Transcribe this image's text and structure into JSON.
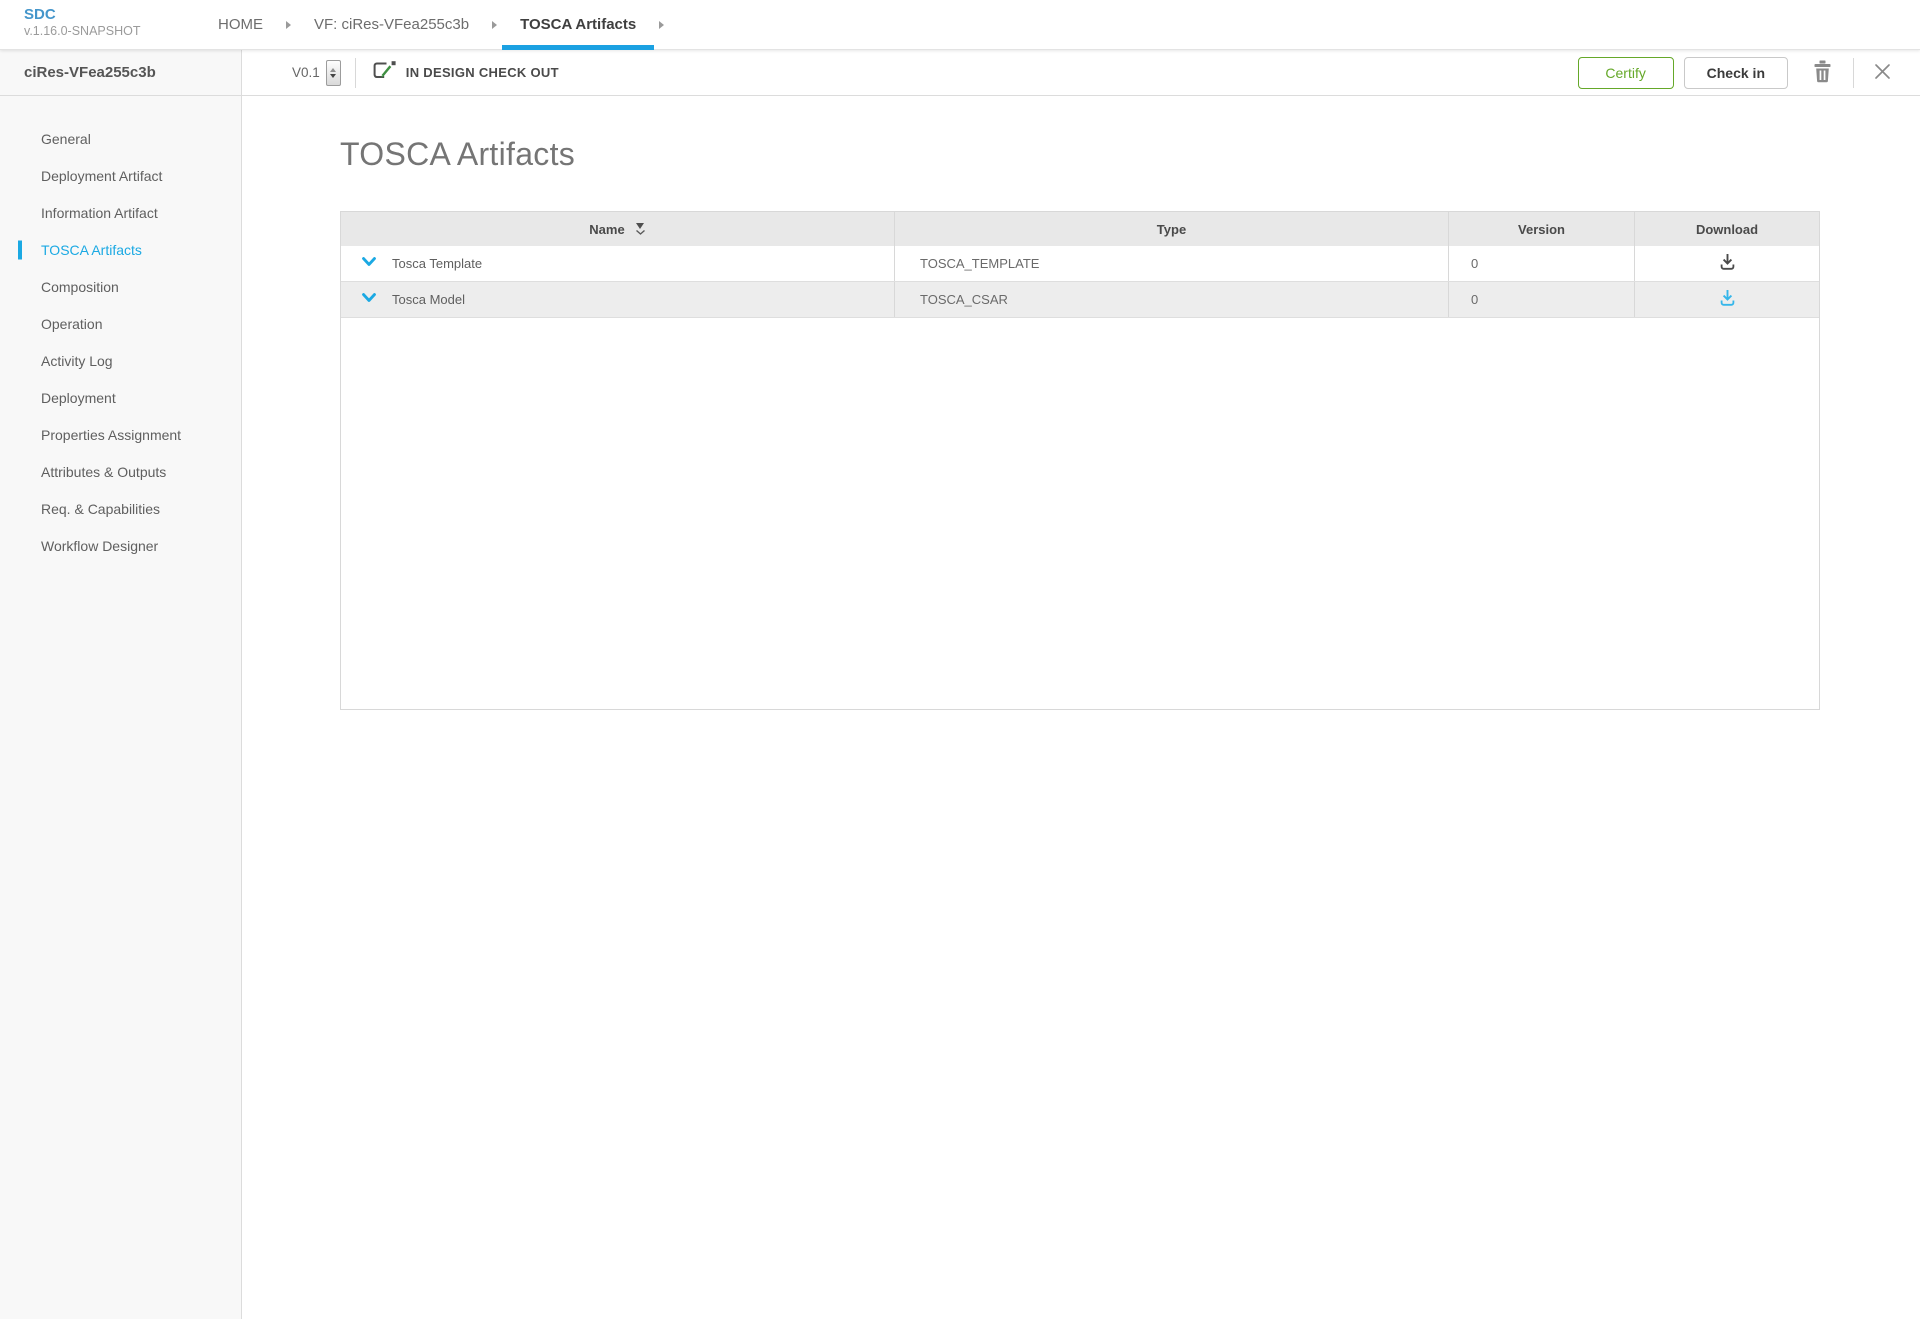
{
  "app": {
    "logo": "SDC",
    "version": "v.1.16.0-SNAPSHOT"
  },
  "breadcrumb": {
    "items": [
      {
        "label": "HOME",
        "active": false
      },
      {
        "label": "VF: ciRes-VFea255c3b",
        "active": false
      },
      {
        "label": "TOSCA Artifacts",
        "active": true
      }
    ]
  },
  "sidebar": {
    "title": "ciRes-VFea255c3b",
    "items": [
      {
        "label": "General",
        "active": false
      },
      {
        "label": "Deployment Artifact",
        "active": false
      },
      {
        "label": "Information Artifact",
        "active": false
      },
      {
        "label": "TOSCA Artifacts",
        "active": true
      },
      {
        "label": "Composition",
        "active": false
      },
      {
        "label": "Operation",
        "active": false
      },
      {
        "label": "Activity Log",
        "active": false
      },
      {
        "label": "Deployment",
        "active": false
      },
      {
        "label": "Properties Assignment",
        "active": false
      },
      {
        "label": "Attributes & Outputs",
        "active": false
      },
      {
        "label": "Req. & Capabilities",
        "active": false
      },
      {
        "label": "Workflow Designer",
        "active": false
      }
    ]
  },
  "toolbar": {
    "version": "V0.1",
    "lifecycle_state": "IN DESIGN CHECK OUT",
    "certify_label": "Certify",
    "checkin_label": "Check in"
  },
  "main": {
    "title": "TOSCA Artifacts",
    "table": {
      "columns": [
        "Name",
        "Type",
        "Version",
        "Download"
      ],
      "rows": [
        {
          "name": "Tosca Template",
          "type": "TOSCA_TEMPLATE",
          "version": "0"
        },
        {
          "name": "Tosca Model",
          "type": "TOSCA_CSAR",
          "version": "0"
        }
      ]
    }
  },
  "icons": {
    "breadcrumb_separator": "right-triangle",
    "checkout": "document-with-green-pencil",
    "version_stepper": "up-down-spinner",
    "trash": "trash-can",
    "close": "x",
    "sort": "trapezoid-with-chevron",
    "row_expander": "chevron-down",
    "download": "arrow-down-into-tray"
  },
  "colors": {
    "accent_blue": "#1ba9e3",
    "logo_blue": "#4596cb",
    "certify_green": "#65a829",
    "download_blue": "#35b6ea",
    "header_gray": "#e8e8e8",
    "sidebar_gray": "#f8f8f8",
    "text_dark": "#4a4a4a"
  }
}
